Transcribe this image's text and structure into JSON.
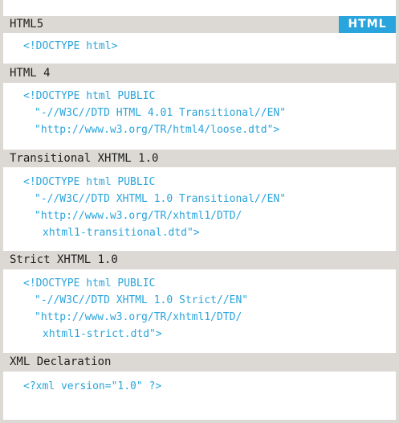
{
  "badge": "HTML",
  "sections": [
    {
      "title": "HTML5",
      "lines": [
        "<!DOCTYPE html>"
      ]
    },
    {
      "title": "HTML 4",
      "lines": [
        "<!DOCTYPE html PUBLIC",
        "\"-//W3C//DTD HTML 4.01 Transitional//EN\"",
        "\"http://www.w3.org/TR/html4/loose.dtd\">"
      ]
    },
    {
      "title": "Transitional XHTML 1.0",
      "lines": [
        "<!DOCTYPE html PUBLIC",
        "\"-//W3C//DTD XHTML 1.0 Transitional//EN\"",
        "\"http://www.w3.org/TR/xhtml1/DTD/",
        "xhtml1-transitional.dtd\">"
      ]
    },
    {
      "title": "Strict XHTML 1.0",
      "lines": [
        "<!DOCTYPE html PUBLIC",
        "\"-//W3C//DTD XHTML 1.0 Strict//EN\"",
        "\"http://www.w3.org/TR/xhtml1/DTD/",
        "xhtml1-strict.dtd\">"
      ]
    },
    {
      "title": "XML Declaration",
      "lines": [
        "<?xml version=\"1.0\" ?>"
      ]
    }
  ]
}
